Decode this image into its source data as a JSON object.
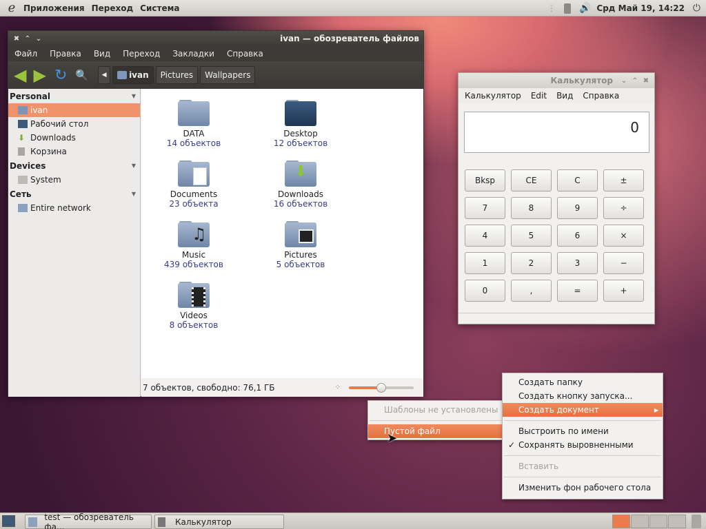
{
  "top_panel": {
    "menus": [
      "Приложения",
      "Переход",
      "Система"
    ],
    "clock": "Срд Май 19, 14:22"
  },
  "file_manager": {
    "title": "ivan — обозреватель файлов",
    "menu": [
      "Файл",
      "Правка",
      "Вид",
      "Переход",
      "Закладки",
      "Справка"
    ],
    "breadcrumbs": [
      "ivan",
      "Pictures",
      "Wallpapers"
    ],
    "sidebar": {
      "sections": [
        {
          "title": "Personal",
          "items": [
            "ivan",
            "Рабочий стол",
            "Downloads",
            "Корзина"
          ]
        },
        {
          "title": "Devices",
          "items": [
            "System"
          ]
        },
        {
          "title": "Сеть",
          "items": [
            "Entire network"
          ]
        }
      ],
      "selected": "ivan"
    },
    "folders": [
      {
        "name": "DATA",
        "count": "14 объектов"
      },
      {
        "name": "Desktop",
        "count": "12 объектов"
      },
      {
        "name": "Documents",
        "count": "23 объекта"
      },
      {
        "name": "Downloads",
        "count": "16 объектов"
      },
      {
        "name": "Music",
        "count": "439 объектов"
      },
      {
        "name": "Pictures",
        "count": "5 объектов"
      },
      {
        "name": "Videos",
        "count": "8 объектов"
      }
    ],
    "status": "7 объектов, свободно: 76,1 ГБ"
  },
  "calculator": {
    "title": "Калькулятор",
    "menu": [
      "Калькулятор",
      "Edit",
      "Вид",
      "Справка"
    ],
    "display": "0",
    "keys": [
      [
        "Bksp",
        "CE",
        "C",
        "±"
      ],
      [
        "7",
        "8",
        "9",
        "÷"
      ],
      [
        "4",
        "5",
        "6",
        "×"
      ],
      [
        "1",
        "2",
        "3",
        "−"
      ],
      [
        "0",
        ",",
        "=",
        "+"
      ]
    ]
  },
  "desktop_menu": {
    "items": [
      "Создать папку",
      "Создать кнопку запуска...",
      "Создать документ",
      "Выстроить по имени",
      "Сохранять выровненными",
      "Вставить",
      "Изменить фон рабочего стола"
    ],
    "highlight_color": "#e97c4a"
  },
  "submenu": {
    "items": [
      "Шаблоны не установлены",
      "Пустой файл"
    ]
  },
  "taskbar": {
    "tasks": [
      "test — обозреватель фа...",
      "Калькулятор"
    ]
  }
}
